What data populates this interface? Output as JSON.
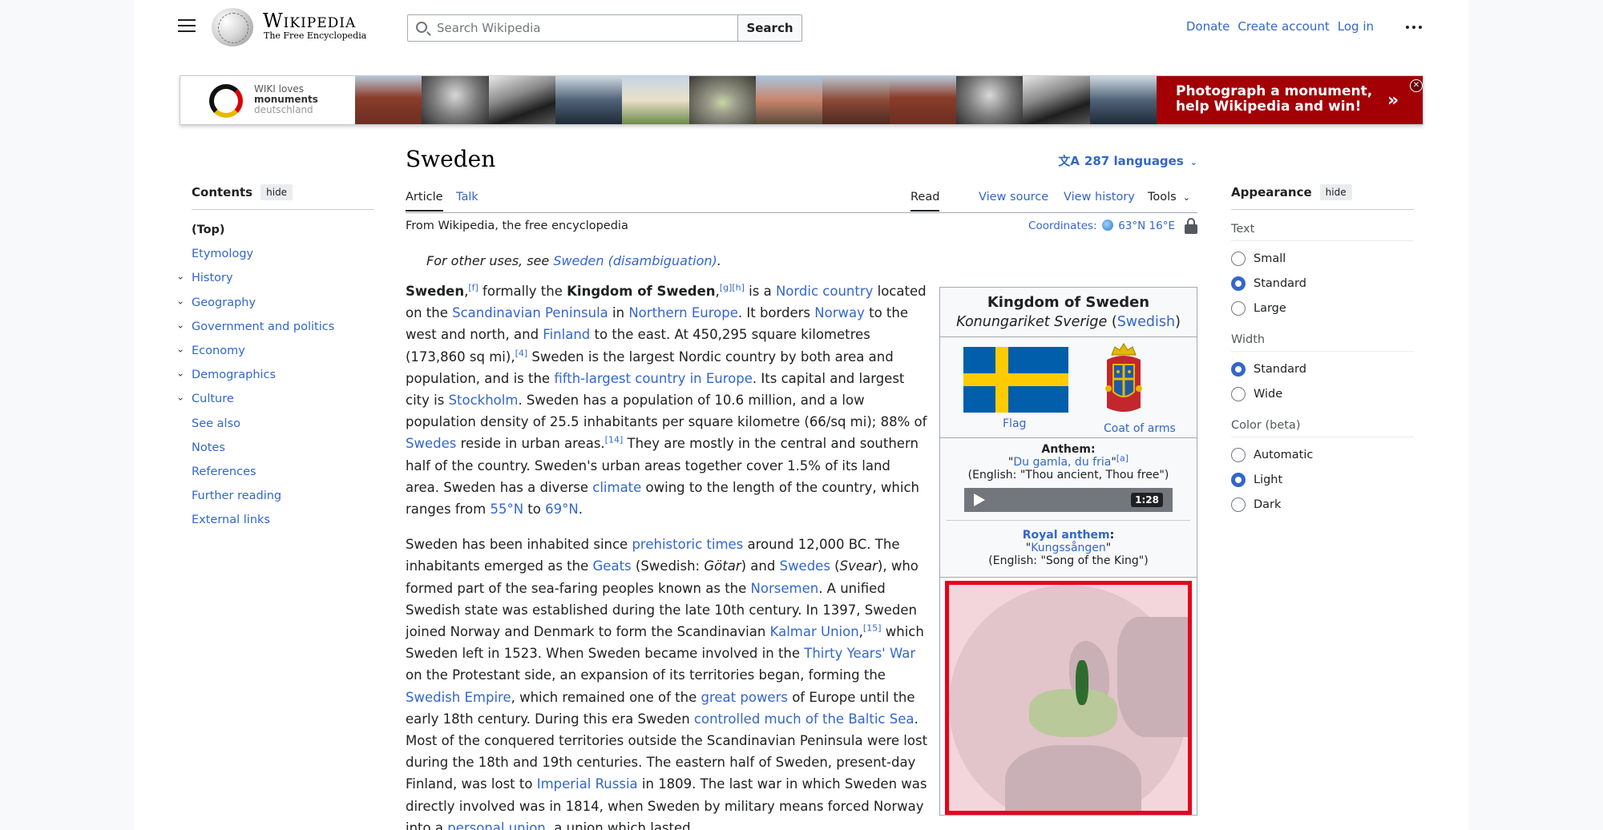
{
  "header": {
    "wordmark": "Wikipedia",
    "tagline": "The Free Encyclopedia",
    "search_placeholder": "Search Wikipedia",
    "search_button": "Search",
    "links": [
      "Donate",
      "Create account",
      "Log in"
    ]
  },
  "banner": {
    "logo_line1": "WIKI loves",
    "logo_line2": "monuments",
    "logo_line3": "deutschland",
    "cta": "Photograph a monument, help Wikipedia and win!",
    "accent": "#a30006"
  },
  "toc": {
    "title": "Contents",
    "hide": "hide",
    "items": [
      {
        "label": "(Top)",
        "expandable": false
      },
      {
        "label": "Etymology",
        "expandable": false
      },
      {
        "label": "History",
        "expandable": true
      },
      {
        "label": "Geography",
        "expandable": true
      },
      {
        "label": "Government and politics",
        "expandable": true
      },
      {
        "label": "Economy",
        "expandable": true
      },
      {
        "label": "Demographics",
        "expandable": true
      },
      {
        "label": "Culture",
        "expandable": true
      },
      {
        "label": "See also",
        "expandable": false
      },
      {
        "label": "Notes",
        "expandable": false
      },
      {
        "label": "References",
        "expandable": false
      },
      {
        "label": "Further reading",
        "expandable": false
      },
      {
        "label": "External links",
        "expandable": false
      }
    ]
  },
  "article": {
    "title": "Sweden",
    "languages": "287 languages",
    "tabs": {
      "article": "Article",
      "talk": "Talk",
      "read": "Read",
      "source": "View source",
      "history": "View history",
      "tools": "Tools"
    },
    "from": "From Wikipedia, the free encyclopedia",
    "coords_label": "Coordinates:",
    "coords_value": "63°N 16°E",
    "hatnote_prefix": "For other uses, see ",
    "hatnote_link": "Sweden (disambiguation)",
    "hatnote_suffix": "."
  },
  "infobox": {
    "title": "Kingdom of Sweden",
    "native": "Konungariket Sverige",
    "native_lang": "Swedish",
    "flag_caption": "Flag",
    "coa_caption": "Coat of arms",
    "anthem_label": "Anthem:",
    "anthem_name": "Du gamla, du fria",
    "anthem_note": "[a]",
    "anthem_english": "(English: \"Thou ancient, Thou free\")",
    "duration": "1:28",
    "royal_label": "Royal anthem",
    "royal_name": "Kungssången",
    "royal_english": "(English: \"Song of the King\")"
  },
  "appearance": {
    "title": "Appearance",
    "hide": "hide",
    "text_label": "Text",
    "text_options": [
      "Small",
      "Standard",
      "Large"
    ],
    "text_selected": 1,
    "width_label": "Width",
    "width_options": [
      "Standard",
      "Wide"
    ],
    "width_selected": 0,
    "color_label": "Color (beta)",
    "color_options": [
      "Automatic",
      "Light",
      "Dark"
    ],
    "color_selected": 1
  },
  "colors": {
    "link": "#3366cc",
    "text": "#202122",
    "flag_blue": "#005eab",
    "flag_yellow": "#fecb00",
    "map_border": "#e8001a"
  }
}
